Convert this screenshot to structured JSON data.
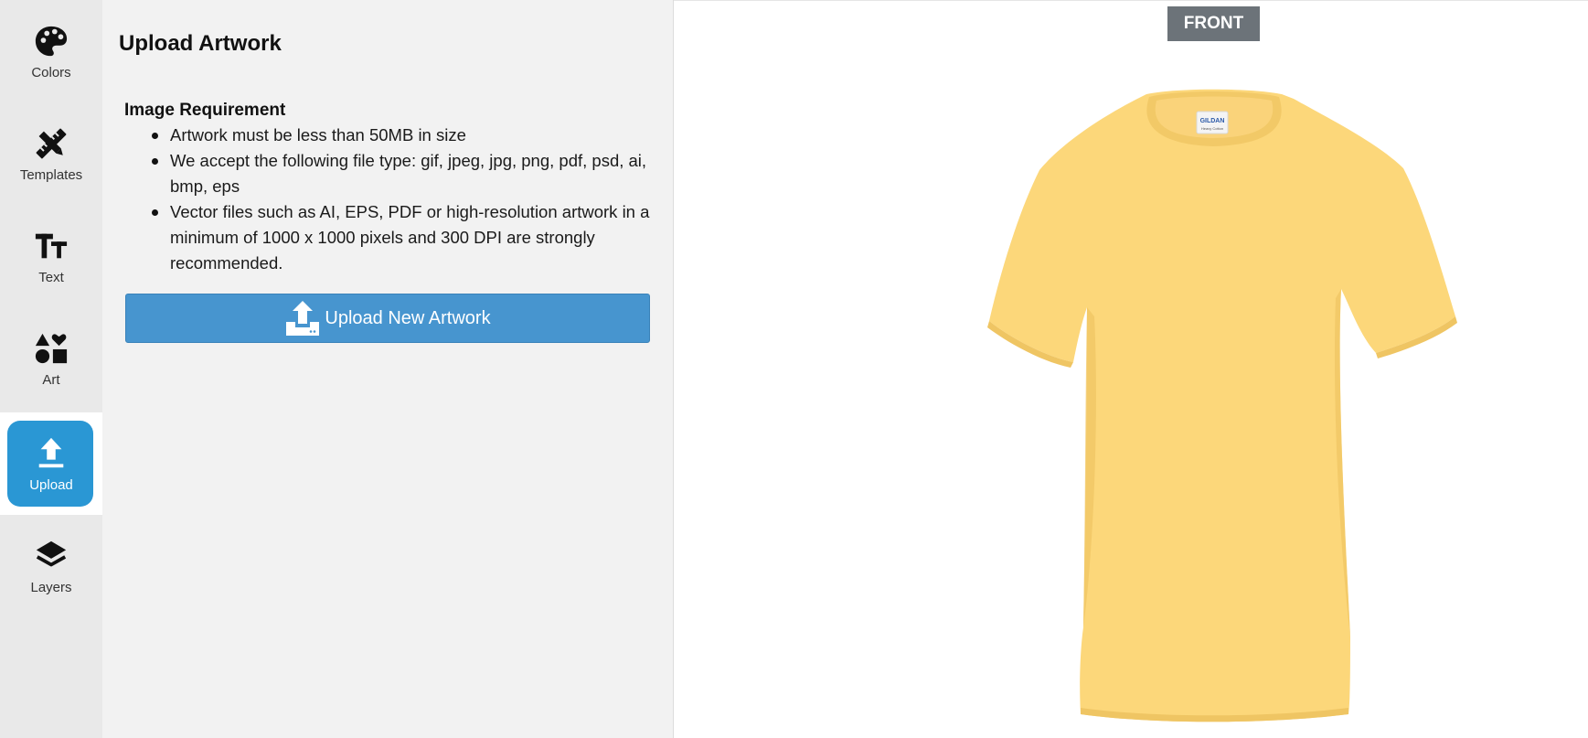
{
  "sidebar": {
    "items": [
      {
        "label": "Colors",
        "icon": "palette-icon"
      },
      {
        "label": "Templates",
        "icon": "pencil-ruler-icon"
      },
      {
        "label": "Text",
        "icon": "text-size-icon"
      },
      {
        "label": "Art",
        "icon": "shapes-icon"
      },
      {
        "label": "Upload",
        "icon": "upload-icon",
        "active": true
      },
      {
        "label": "Layers",
        "icon": "layers-icon"
      }
    ],
    "active_color": "#2a97d4"
  },
  "panel": {
    "title": "Upload Artwork",
    "requirement_title": "Image Requirement",
    "requirements": [
      "Artwork must be less than 50MB in size",
      "We accept the following file type: gif, jpeg, jpg, png, pdf, psd, ai, bmp, eps",
      "Vector files such as AI, EPS, PDF or high-resolution artwork in a minimum of 1000 x 1000 pixels and 300 DPI are strongly recommended."
    ],
    "upload_button_label": "Upload New Artwork",
    "button_color": "#4795cf"
  },
  "stage": {
    "view_tab_label": "FRONT",
    "product_color": "#fcd77a",
    "tag_text": "GILDAN",
    "tag_subtext": "Heavy Cotton"
  }
}
